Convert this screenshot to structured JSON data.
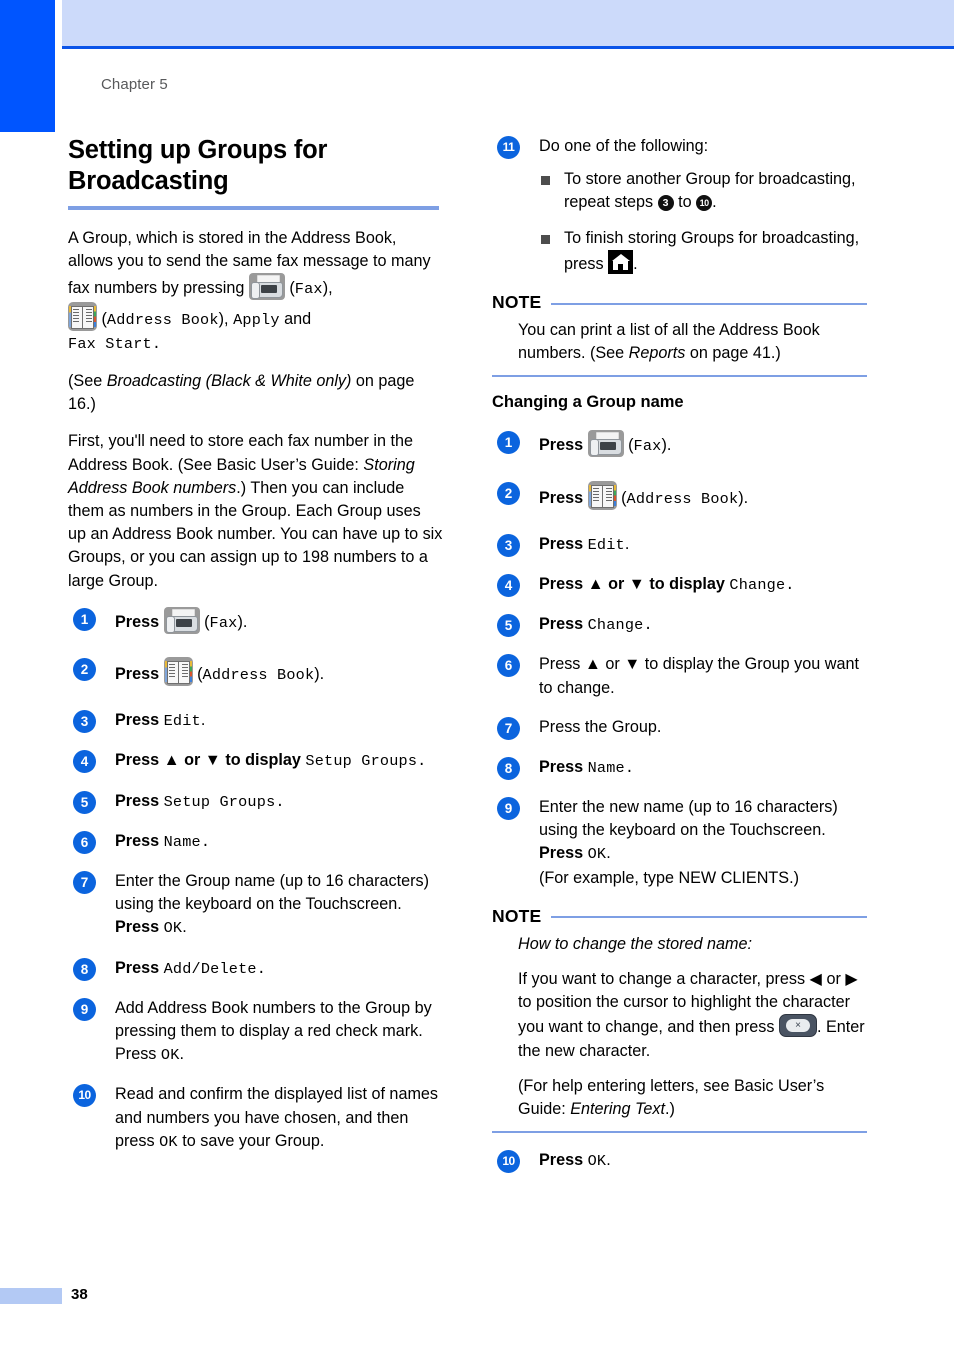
{
  "page": {
    "chapter_label": "Chapter 5",
    "page_number": "38",
    "accent_blue": "#0055ff",
    "header_band_color": "#ccdafa",
    "rule_color": "#7e9fe4",
    "step_bullet_color": "#0b64de"
  },
  "left_column": {
    "title": "Setting up Groups for Broadcasting",
    "intro_1_a": "A Group, which is stored in the Address Book, allows you to send the same fax message to many fax numbers by pressing",
    "intro_1_fax": "Fax",
    "intro_1_b": "),",
    "intro_1_addressbook": "Address Book",
    "intro_1_c": "),",
    "intro_1_apply": "Apply",
    "intro_1_d": "and",
    "intro_1_faxstart": "Fax Start.",
    "intro_2_a": "(See ",
    "intro_2_italic": "Broadcasting (Black & White only)",
    "intro_2_b": " on page 16.)",
    "intro_3_a": "First, you'll need to store each fax number in the Address Book. (See Basic User’s Guide: ",
    "intro_3_italic": "Storing Address Book numbers",
    "intro_3_b": ".) Then you can include them as numbers in the Group. Each Group uses up an Address Book number. You can have up to six Groups, or you can assign up to 198 numbers to a large Group.",
    "steps": [
      {
        "num": "1",
        "pre": "Press ",
        "icon": "fax-icon",
        "post_paren": "Fax",
        "post": ")."
      },
      {
        "num": "2",
        "pre": "Press ",
        "icon": "address-book-icon",
        "post_paren": "Address Book",
        "post": ")."
      },
      {
        "num": "3",
        "pre": "Press ",
        "mono": "Edit",
        "post": "."
      },
      {
        "num": "4",
        "pre": "Press ▲ or ▼ to display ",
        "mono": "Setup Groups.",
        "post": ""
      },
      {
        "num": "5",
        "pre": "Press ",
        "mono": "Setup Groups.",
        "post": ""
      },
      {
        "num": "6",
        "pre": "Press ",
        "mono": "Name.",
        "post": ""
      },
      {
        "num": "7",
        "text": "Enter the Group name (up to 16 characters)  using the keyboard on the Touchscreen.",
        "press_label": "Press ",
        "press_mono": "OK",
        "press_post": "."
      },
      {
        "num": "8",
        "pre": "Press ",
        "mono": "Add/Delete.",
        "post": ""
      },
      {
        "num": "9",
        "text_a": "Add Address Book numbers to the Group by pressing them to display a red check mark. Press ",
        "mono": "OK",
        "text_b": "."
      },
      {
        "num": "10",
        "text_a": "Read and confirm the displayed list of names and numbers you have chosen, and then press ",
        "mono": "OK",
        "text_b": " to save your Group."
      }
    ]
  },
  "right_column": {
    "step11": {
      "num": "11",
      "heading": "Do one of the following:",
      "bullets": [
        {
          "text_a": "To store another Group for broadcasting, repeat steps ",
          "ref_from": "3",
          "text_mid": " to ",
          "ref_to": "10",
          "text_b": "."
        },
        {
          "text_a": "To finish storing Groups for broadcasting, press ",
          "icon": "home-icon",
          "text_b": "."
        }
      ]
    },
    "note_1": {
      "label": "NOTE",
      "text_a": "You can print a list of all the Address Book numbers. (See ",
      "italic": "Reports",
      "text_b": " on page 41.)"
    },
    "sub_heading": "Changing a Group name",
    "steps": [
      {
        "num": "1",
        "pre": "Press ",
        "icon": "fax-icon",
        "post_paren": "Fax",
        "post": ")."
      },
      {
        "num": "2",
        "pre": "Press ",
        "icon": "address-book-icon",
        "post_paren": "Address Book",
        "post": ")."
      },
      {
        "num": "3",
        "pre": "Press ",
        "mono": "Edit",
        "post": "."
      },
      {
        "num": "4",
        "pre": "Press ▲ or ▼ to display ",
        "mono": "Change.",
        "post": ""
      },
      {
        "num": "5",
        "pre": "Press ",
        "mono": "Change.",
        "post": ""
      },
      {
        "num": "6",
        "text": "Press ▲ or ▼ to display the Group you want to change."
      },
      {
        "num": "7",
        "text": "Press the Group."
      },
      {
        "num": "8",
        "pre": "Press ",
        "mono": "Name.",
        "post": ""
      },
      {
        "num": "9",
        "text": "Enter the new name (up to 16 characters) using the keyboard on the Touchscreen.",
        "press_label": "Press ",
        "press_mono": "OK",
        "press_post": ".",
        "example": "(For example, type NEW CLIENTS.)"
      }
    ],
    "note_2": {
      "label": "NOTE",
      "italic_lead": "How to change the stored name:",
      "para_a": "If you want to change a character, press ◀ or ▶ to position the cursor to highlight the character you want to change, and then press ",
      "icon": "backspace-icon",
      "para_b": ". Enter the new character.",
      "para_c_a": "(For help entering letters, see Basic User’s Guide: ",
      "para_c_italic": "Entering Text",
      "para_c_b": ".)"
    },
    "final_step": {
      "num": "10",
      "pre": "Press ",
      "mono": "OK",
      "post": "."
    }
  }
}
